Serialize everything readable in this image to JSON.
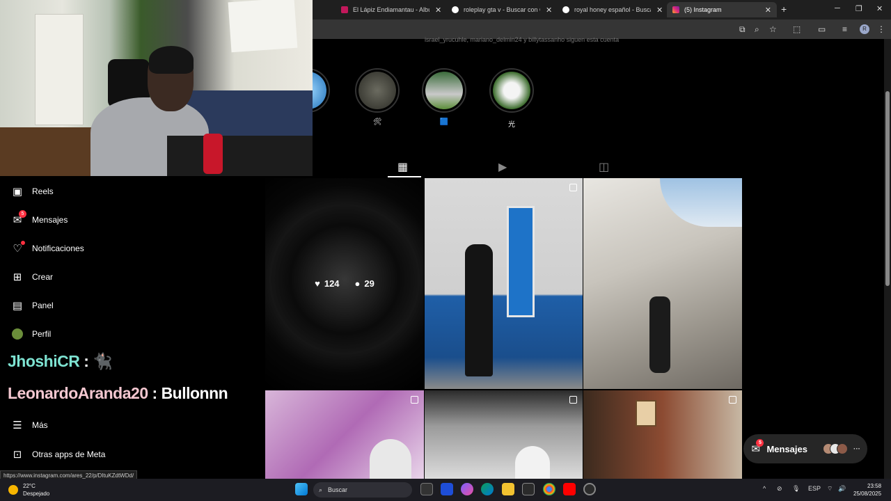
{
  "browser": {
    "tabs": [
      {
        "title": "El Lápiz Endiamantau - Album",
        "color": "#c2185b"
      },
      {
        "title": "roleplay gta v - Buscar con Goo",
        "color": "#4285f4"
      },
      {
        "title": "royal honey español - Buscar co",
        "color": "#4285f4"
      },
      {
        "title": "(5) Instagram",
        "color": "#dd2a7b",
        "active": true
      }
    ],
    "new_tab": "+",
    "avatar_letter": "R",
    "status_url": "https://www.instagram.com/ares_22/p/DItuKZdtWDd/"
  },
  "profile": {
    "followed_by": "israel_yrucuhle, mariano_delmin24 y billytassanho siguen esta cuenta",
    "highlights": [
      {
        "label": ""
      },
      {
        "label": "🛠"
      },
      {
        "label": "🟦"
      },
      {
        "label": "光"
      }
    ]
  },
  "grid": {
    "hover_post": {
      "likes": "124",
      "comments": "29"
    }
  },
  "sidebar": {
    "items": [
      {
        "label": "Reels",
        "icon": "reels-icon"
      },
      {
        "label": "Mensajes",
        "icon": "messenger-icon",
        "badge": "5"
      },
      {
        "label": "Notificaciones",
        "icon": "heart-icon",
        "dot": true
      },
      {
        "label": "Crear",
        "icon": "plus-square-icon"
      },
      {
        "label": "Panel",
        "icon": "chart-icon"
      },
      {
        "label": "Perfil",
        "icon": "avatar"
      },
      {
        "label": "Más",
        "icon": "menu-icon"
      },
      {
        "label": "Otras apps de Meta",
        "icon": "meta-apps-icon"
      }
    ]
  },
  "chat_overlay": [
    {
      "user": "JhoshiCR",
      "sep": " : ",
      "msg": "🐈‍⬛"
    },
    {
      "user": "LeonardoAranda20",
      "sep": " : ",
      "msg": "Bullonnn"
    }
  ],
  "messages_pill": {
    "label": "Mensajes",
    "badge": "5",
    "more": "···"
  },
  "taskbar": {
    "temp": "22°C",
    "weather": "Despejado",
    "search_placeholder": "Buscar",
    "lang": "ESP",
    "time": "23:58",
    "date": "25/08/2025"
  }
}
